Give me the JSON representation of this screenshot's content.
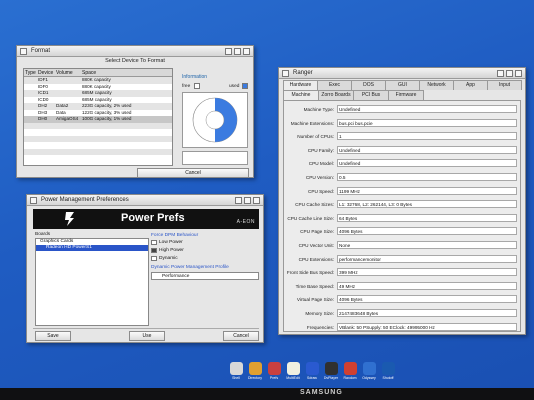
{
  "format": {
    "title": "Format",
    "subtitle": "Select Device To Format",
    "columns": [
      "Type",
      "Device",
      "Volume",
      "Space"
    ],
    "rows": [
      {
        "device": "IDF1",
        "volume": "",
        "space": "880K capacity"
      },
      {
        "device": "IDF0",
        "volume": "",
        "space": "880K capacity"
      },
      {
        "device": "ICD1",
        "volume": "",
        "space": "685M capacity"
      },
      {
        "device": "ICD0",
        "volume": "",
        "space": "685M capacity"
      },
      {
        "device": "DH2",
        "volume": "Data2",
        "space": "223G capacity, 2% used"
      },
      {
        "device": "DH3",
        "volume": "Data",
        "space": "122G capacity, 3% used"
      },
      {
        "device": "DH0",
        "volume": "AmigaOS4",
        "space": "100G capacity, 1% used"
      }
    ],
    "info_label": "Information",
    "free_label": "free",
    "used_label": "used",
    "cancel_label": "Cancel",
    "colors": {
      "used": "#3b7be0",
      "free": "#ffffff"
    }
  },
  "power": {
    "title": "Power Management Preferences",
    "banner_title": "Power Prefs",
    "banner_brand": "A-EON",
    "boards_label": "Boards",
    "boards": [
      "Graphics Cards",
      "Radeon HD PowerS1"
    ],
    "dpm_label": "Force DPM Behaviour",
    "options": [
      "Low Power",
      "High Power",
      "Dynamic"
    ],
    "selected_option": "High Power",
    "profile_label": "Dynamic Power Management Profile",
    "profile_value": "Performance",
    "save_label": "Save",
    "use_label": "Use",
    "cancel_label": "Cancel"
  },
  "ranger": {
    "title": "Ranger",
    "tabs": [
      "Hardware",
      "Exec",
      "DOS",
      "GUI",
      "Network",
      "App",
      "Input"
    ],
    "active_tab": "Hardware",
    "subtabs": [
      "Machine",
      "Zorro Boards",
      "PCI Bus",
      "Firmware"
    ],
    "active_subtab": "Machine",
    "properties": [
      {
        "label": "Machine Type:",
        "value": "Undefined"
      },
      {
        "label": "Machine Extensions:",
        "value": "bus.pci bus.pcie"
      },
      {
        "label": "Number of CPUs:",
        "value": "1"
      },
      {
        "label": "CPU Family:",
        "value": "Undefined"
      },
      {
        "label": "CPU Model:",
        "value": "Undefined"
      },
      {
        "label": "CPU Version:",
        "value": "0.5"
      },
      {
        "label": "CPU Speed:",
        "value": "1199 MHz"
      },
      {
        "label": "CPU Cache Sizes:",
        "value": "L1: 32768, L2: 262144, L3: 0 Bytes"
      },
      {
        "label": "CPU Cache Line Size:",
        "value": "64 Bytes"
      },
      {
        "label": "CPU Page Size:",
        "value": "4096 Bytes"
      },
      {
        "label": "CPU Vector Unit:",
        "value": "None"
      },
      {
        "label": "CPU Extensions:",
        "value": "performancemonitor"
      },
      {
        "label": "Front Side Bus Speed:",
        "value": "399 MHz"
      },
      {
        "label": "Time Base Speed:",
        "value": "49 MHz"
      },
      {
        "label": "Virtual Page Size:",
        "value": "4096 Bytes"
      },
      {
        "label": "Memory Size:",
        "value": "2147483648 Bytes"
      },
      {
        "label": "Frequencies:",
        "value": "VBlank: 50 PSupply: 50 EClock: 49995000 Hz"
      }
    ]
  },
  "dock": {
    "items": [
      {
        "label": "Shell",
        "icon": "shell-icon",
        "color": "#d8d8d8"
      },
      {
        "label": "Directory",
        "icon": "directory-icon",
        "color": "#e0a030"
      },
      {
        "label": "Prefs",
        "icon": "prefs-icon",
        "color": "#c84040"
      },
      {
        "label": "MultiEdit",
        "icon": "notepad-icon",
        "color": "#f0f0e0"
      },
      {
        "label": "Sdraw",
        "icon": "draw-icon",
        "color": "#2a5ad0"
      },
      {
        "label": "DvPlayer",
        "icon": "film-icon",
        "color": "#303030"
      },
      {
        "label": "Raxdom",
        "icon": "game-icon",
        "color": "#d04030"
      },
      {
        "label": "Odyssey",
        "icon": "globe-icon",
        "color": "#3070d0"
      },
      {
        "label": "Shutoff",
        "icon": "power-icon",
        "color": "#1a5ab0"
      }
    ]
  },
  "monitor_brand": "SAMSUNG"
}
